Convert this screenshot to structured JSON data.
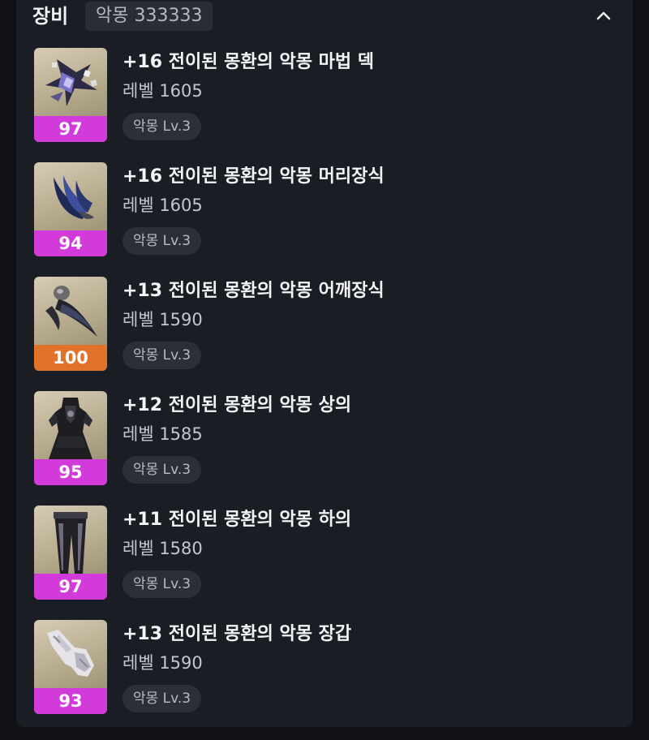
{
  "section": {
    "title": "장비",
    "badge": "악몽 333333",
    "collapse_icon": "chevron-up-icon"
  },
  "colors": {
    "quality_purple": "#d23ad9",
    "quality_orange": "#e0722a",
    "panel_bg": "#1b1d24",
    "tag_bg": "#2c2f37"
  },
  "items": [
    {
      "name": "+16 전이된 몽환의 악몽 마법 덱",
      "level": "레벨 1605",
      "quality": "97",
      "quality_color": "#d23ad9",
      "tag": "악몽 Lv.3",
      "icon": "magic-deck-icon"
    },
    {
      "name": "+16 전이된 몽환의 악몽 머리장식",
      "level": "레벨 1605",
      "quality": "94",
      "quality_color": "#d23ad9",
      "tag": "악몽 Lv.3",
      "icon": "headpiece-icon"
    },
    {
      "name": "+13 전이된 몽환의 악몽 어깨장식",
      "level": "레벨 1590",
      "quality": "100",
      "quality_color": "#e0722a",
      "tag": "악몽 Lv.3",
      "icon": "shoulder-icon"
    },
    {
      "name": "+12 전이된 몽환의 악몽 상의",
      "level": "레벨 1585",
      "quality": "95",
      "quality_color": "#d23ad9",
      "tag": "악몽 Lv.3",
      "icon": "top-armor-icon"
    },
    {
      "name": "+11 전이된 몽환의 악몽 하의",
      "level": "레벨 1580",
      "quality": "97",
      "quality_color": "#d23ad9",
      "tag": "악몽 Lv.3",
      "icon": "pants-icon"
    },
    {
      "name": "+13 전이된 몽환의 악몽 장갑",
      "level": "레벨 1590",
      "quality": "93",
      "quality_color": "#d23ad9",
      "tag": "악몽 Lv.3",
      "icon": "gloves-icon"
    }
  ]
}
